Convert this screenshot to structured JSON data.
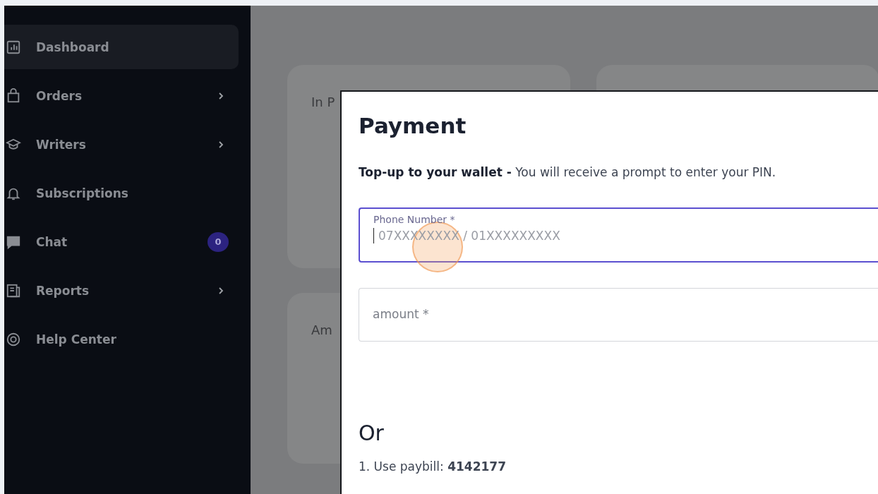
{
  "sidebar": {
    "items": [
      {
        "label": "Dashboard",
        "selected": true,
        "has_submenu": false
      },
      {
        "label": "Orders",
        "selected": false,
        "has_submenu": true
      },
      {
        "label": "Writers",
        "selected": false,
        "has_submenu": true
      },
      {
        "label": "Subscriptions",
        "selected": false,
        "has_submenu": false
      },
      {
        "label": "Chat",
        "selected": false,
        "has_submenu": false,
        "badge": "0"
      },
      {
        "label": "Reports",
        "selected": false,
        "has_submenu": true
      },
      {
        "label": "Help Center",
        "selected": false,
        "has_submenu": false
      }
    ]
  },
  "cards": [
    {
      "title": "In P"
    },
    {
      "title": "Am"
    }
  ],
  "modal": {
    "title": "Payment",
    "description": "**Top-up to your wallet -** You will receive a prompt to enter your PIN.",
    "fields": [
      {
        "label": "Phone Number *",
        "placeholder": "07XXXXXXXX / 01XXXXXXXXX",
        "focused": true
      },
      {
        "label": "amount *",
        "focused": false
      }
    ],
    "or_heading": "Or",
    "paybill": "1. Use paybill: **4142177**"
  }
}
